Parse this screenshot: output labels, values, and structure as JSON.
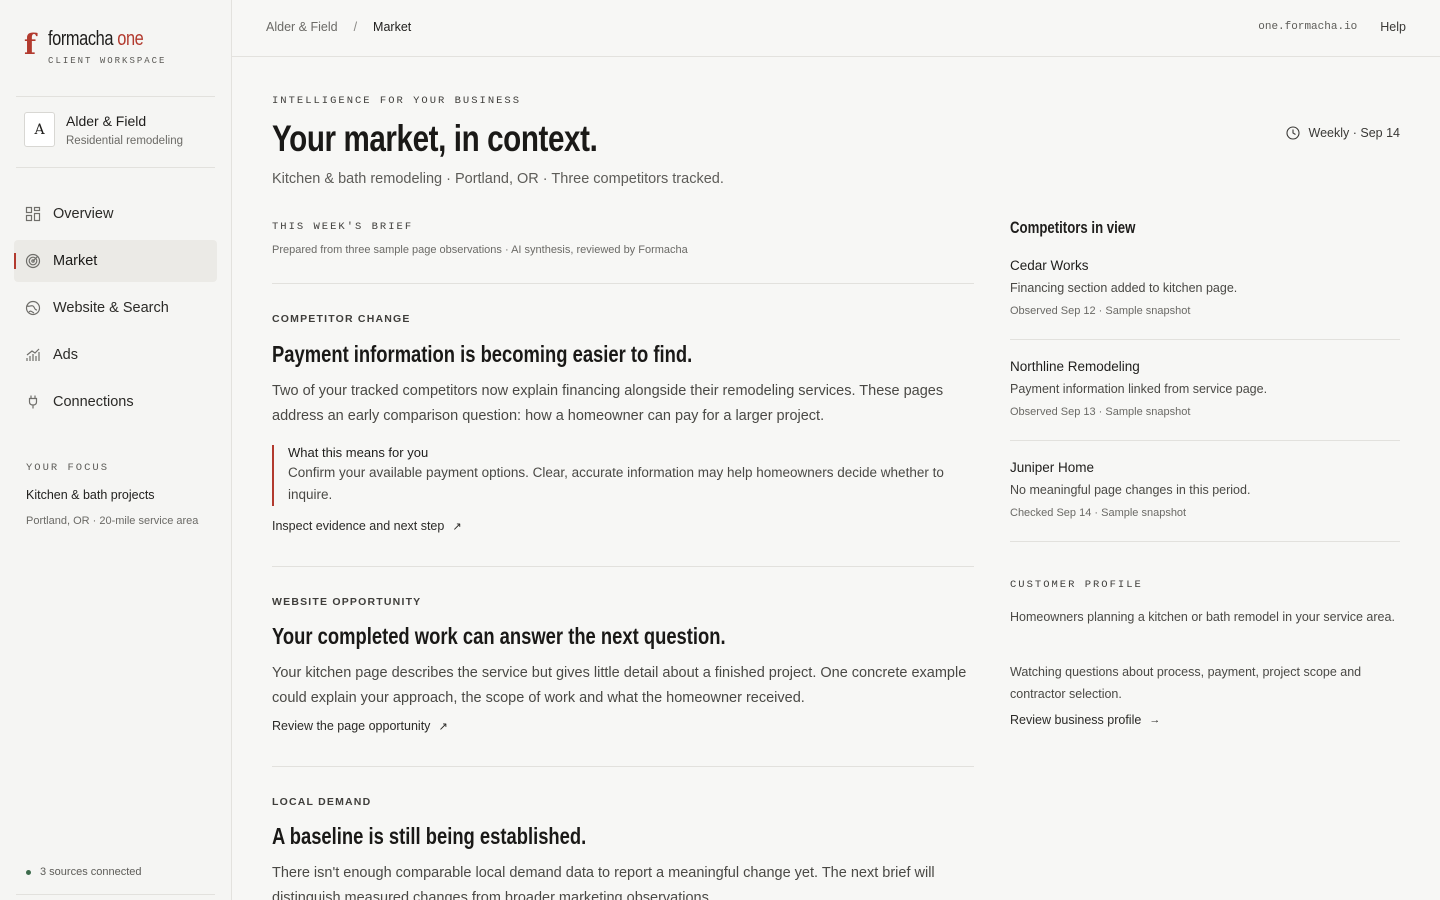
{
  "brand": {
    "name": "formacha",
    "name_suffix": "one",
    "mark": "f",
    "sub": "CLIENT WORKSPACE"
  },
  "account": {
    "initial": "A",
    "name": "Alder & Field",
    "sub": "Residential remodeling"
  },
  "nav": [
    {
      "label": "Overview",
      "icon": "grid-icon",
      "active": false
    },
    {
      "label": "Market",
      "icon": "target-icon",
      "active": true
    },
    {
      "label": "Website & Search",
      "icon": "globe-icon",
      "active": false
    },
    {
      "label": "Ads",
      "icon": "bar-chart-icon",
      "active": false
    },
    {
      "label": "Connections",
      "icon": "plug-icon",
      "active": false
    }
  ],
  "focus": {
    "label": "YOUR FOCUS",
    "title": "Kitchen & bath projects",
    "sub": "Portland, OR · 20-mile service area"
  },
  "sources": "3 sources connected",
  "topbar": {
    "crumb_root": "Alder & Field",
    "crumb_sep": "/",
    "crumb_current": "Market",
    "domain": "one.formacha.io",
    "help": "Help"
  },
  "hero": {
    "eyebrow": "INTELLIGENCE FOR YOUR BUSINESS",
    "title": "Your market, in context.",
    "sub": "Kitchen & bath remodeling · Portland, OR · Three competitors tracked.",
    "cadence": "Weekly · Sep 14"
  },
  "brief": {
    "label": "THIS WEEK'S BRIEF",
    "note": "Prepared from three sample page observations · AI synthesis, reviewed by Formacha"
  },
  "sections": [
    {
      "label": "COMPETITOR CHANGE",
      "title": "Payment information is becoming easier to find.",
      "body": "Two of your tracked competitors now explain financing alongside their remodeling services. These pages address an early comparison question: how a homeowner can pay for a larger project.",
      "callout_title": "What this means for you",
      "callout_body": "Confirm your available payment options. Clear, accurate information may help homeowners decide whether to inquire.",
      "link": "Inspect evidence and next step"
    },
    {
      "label": "WEBSITE OPPORTUNITY",
      "title": "Your completed work can answer the next question.",
      "body": "Your kitchen page describes the service but gives little detail about a finished project. One concrete example could explain your approach, the scope of work and what the homeowner received.",
      "link": "Review the page opportunity"
    },
    {
      "label": "LOCAL DEMAND",
      "title": "A baseline is still being established.",
      "body": "There isn't enough comparable local demand data to report a meaningful change yet. The next brief will distinguish measured changes from broader marketing observations."
    }
  ],
  "competitors": {
    "title": "Competitors in view",
    "items": [
      {
        "name": "Cedar Works",
        "desc": "Financing section added to kitchen page.",
        "meta": "Observed Sep 12 · Sample snapshot"
      },
      {
        "name": "Northline Remodeling",
        "desc": "Payment information linked from service page.",
        "meta": "Observed Sep 13 · Sample snapshot"
      },
      {
        "name": "Juniper Home",
        "desc": "No meaningful page changes in this period.",
        "meta": "Checked Sep 14 · Sample snapshot"
      }
    ]
  },
  "profile": {
    "label": "CUSTOMER PROFILE",
    "p1": "Homeowners planning a kitchen or bath remodel in your service area.",
    "p2": "Watching questions about process, payment, project scope and contractor selection.",
    "link": "Review business profile"
  },
  "colors": {
    "accent": "#b23a2e",
    "status_ok": "#3d6b4c"
  }
}
